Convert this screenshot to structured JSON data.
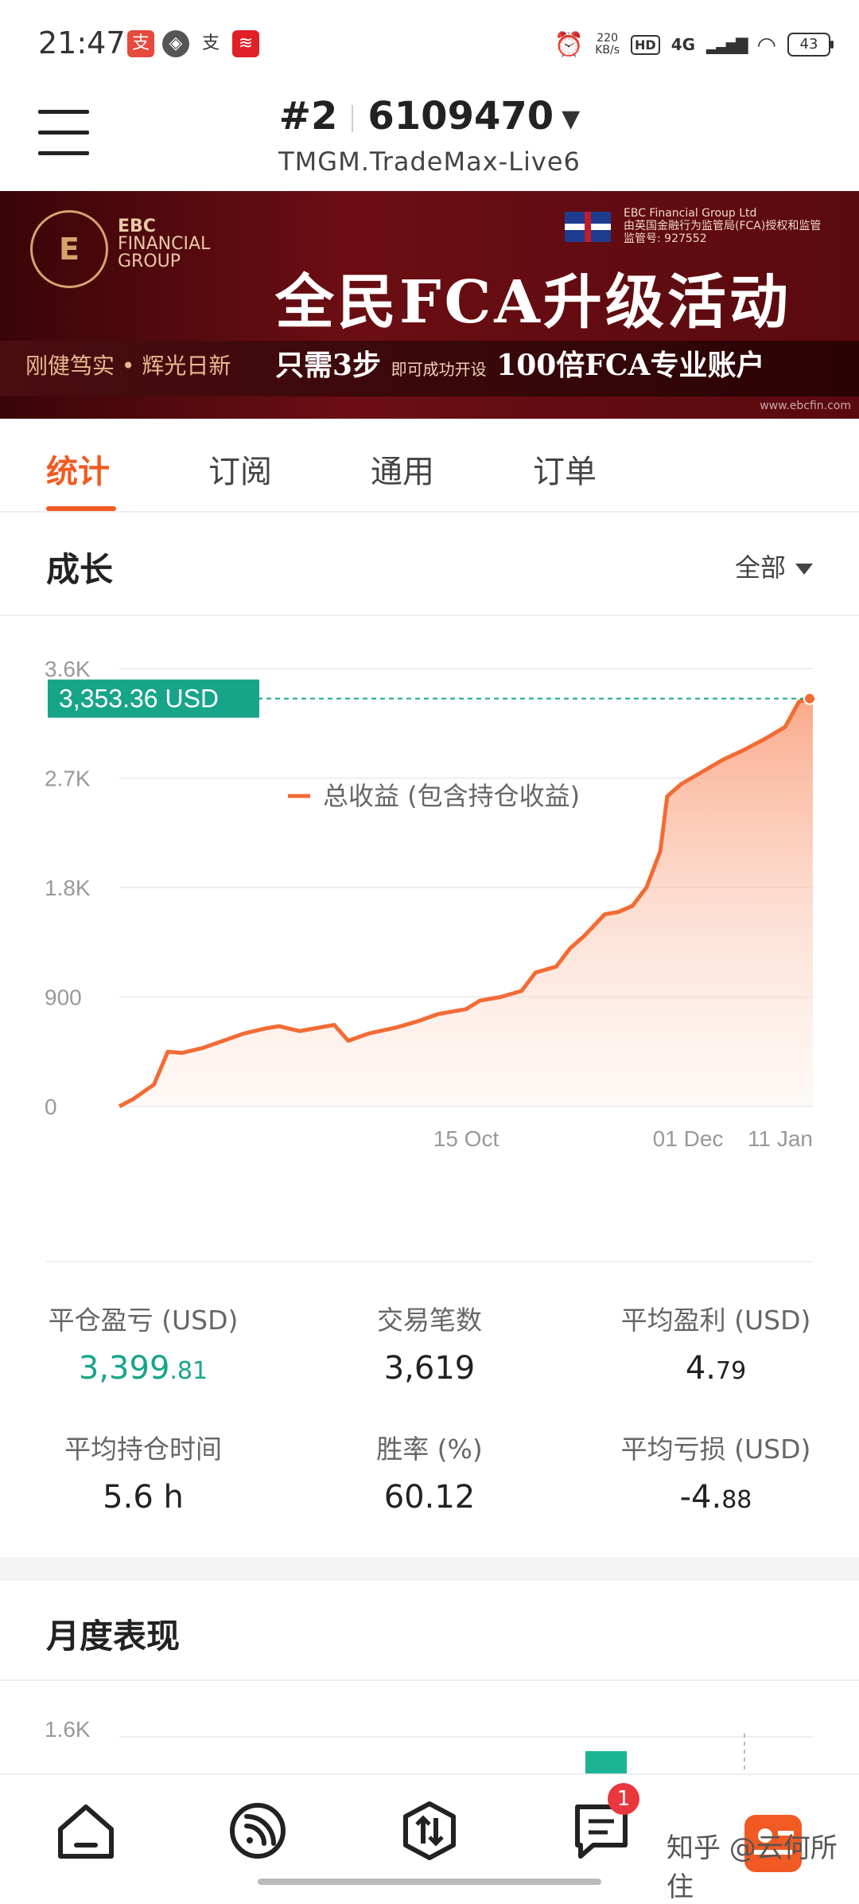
{
  "status": {
    "time": "21:47",
    "net_speed_value": "220",
    "net_speed_unit": "KB/s",
    "hd": "HD",
    "network": "4G",
    "battery": "43"
  },
  "header": {
    "account_index": "#2",
    "account_number": "6109470",
    "server": "TMGM.TradeMax-Live6"
  },
  "banner": {
    "logo_text": "EBC\nFINANCIAL\nGROUP",
    "legal_line1": "EBC Financial Group Ltd",
    "legal_line2": "由英国金融行为监管局(FCA)授权和监管",
    "legal_line3": "监管号: 927552",
    "headline": "全民FCA升级活动",
    "slogan": "刚健笃实 • 辉光日新",
    "cta_main": "只需3步",
    "cta_small": "即可成功开设",
    "cta_tail": "100倍FCA专业账户",
    "url": "www.ebcfin.com"
  },
  "tabs": [
    "统计",
    "订阅",
    "通用",
    "订单"
  ],
  "growth": {
    "title": "成长",
    "range": "全部"
  },
  "chart_data": {
    "type": "area",
    "title": "",
    "xlabel": "",
    "ylabel": "",
    "ylim": [
      0,
      3600
    ],
    "yticks": [
      "0",
      "900",
      "1.8K",
      "2.7K",
      "3.6K"
    ],
    "xticks": [
      "15 Oct",
      "01 Dec",
      "11 Jan"
    ],
    "current_value_label": "3,353.36 USD",
    "current_value": 3353.36,
    "series": [
      {
        "name": "总收益 (包含持仓收益)",
        "color": "#f26b35",
        "points": [
          [
            0,
            0
          ],
          [
            0.02,
            60
          ],
          [
            0.05,
            180
          ],
          [
            0.07,
            450
          ],
          [
            0.09,
            440
          ],
          [
            0.12,
            480
          ],
          [
            0.15,
            540
          ],
          [
            0.18,
            600
          ],
          [
            0.21,
            640
          ],
          [
            0.23,
            660
          ],
          [
            0.26,
            620
          ],
          [
            0.29,
            650
          ],
          [
            0.31,
            670
          ],
          [
            0.33,
            540
          ],
          [
            0.36,
            600
          ],
          [
            0.4,
            650
          ],
          [
            0.43,
            700
          ],
          [
            0.46,
            760
          ],
          [
            0.48,
            780
          ],
          [
            0.5,
            800
          ],
          [
            0.52,
            870
          ],
          [
            0.55,
            900
          ],
          [
            0.58,
            950
          ],
          [
            0.6,
            1100
          ],
          [
            0.63,
            1150
          ],
          [
            0.65,
            1300
          ],
          [
            0.67,
            1400
          ],
          [
            0.7,
            1580
          ],
          [
            0.72,
            1600
          ],
          [
            0.74,
            1650
          ],
          [
            0.76,
            1800
          ],
          [
            0.78,
            2100
          ],
          [
            0.79,
            2550
          ],
          [
            0.81,
            2650
          ],
          [
            0.84,
            2750
          ],
          [
            0.87,
            2850
          ],
          [
            0.9,
            2930
          ],
          [
            0.93,
            3020
          ],
          [
            0.96,
            3120
          ],
          [
            0.98,
            3330
          ],
          [
            1.0,
            3353.36
          ]
        ]
      }
    ],
    "legend": [
      "总收益 (包含持仓收益)"
    ]
  },
  "stats": [
    {
      "label": "平仓盈亏 (USD)",
      "int": "3,399",
      "dec": ".81",
      "positive": true
    },
    {
      "label": "交易笔数",
      "int": "3,619",
      "dec": "",
      "positive": false
    },
    {
      "label": "平均盈利 (USD)",
      "int": "4.",
      "dec": "79",
      "positive": false
    },
    {
      "label": "平均持仓时间",
      "int": "5.6 h",
      "dec": "",
      "positive": false
    },
    {
      "label": "胜率 (%)",
      "int": "60.12",
      "dec": "",
      "positive": false
    },
    {
      "label": "平均亏损 (USD)",
      "int": "-4.",
      "dec": "88",
      "positive": false
    }
  ],
  "monthly": {
    "title": "月度表现",
    "ytick": "1.6K"
  },
  "bottom_nav": {
    "items": [
      "home-icon",
      "signal-icon",
      "trade-icon",
      "messages-icon",
      "profile-icon"
    ],
    "badge": "1"
  },
  "watermark": "知乎 @云何所住",
  "colors": {
    "accent": "#f15a22",
    "positive": "#17a589",
    "series": "#f26b35"
  }
}
